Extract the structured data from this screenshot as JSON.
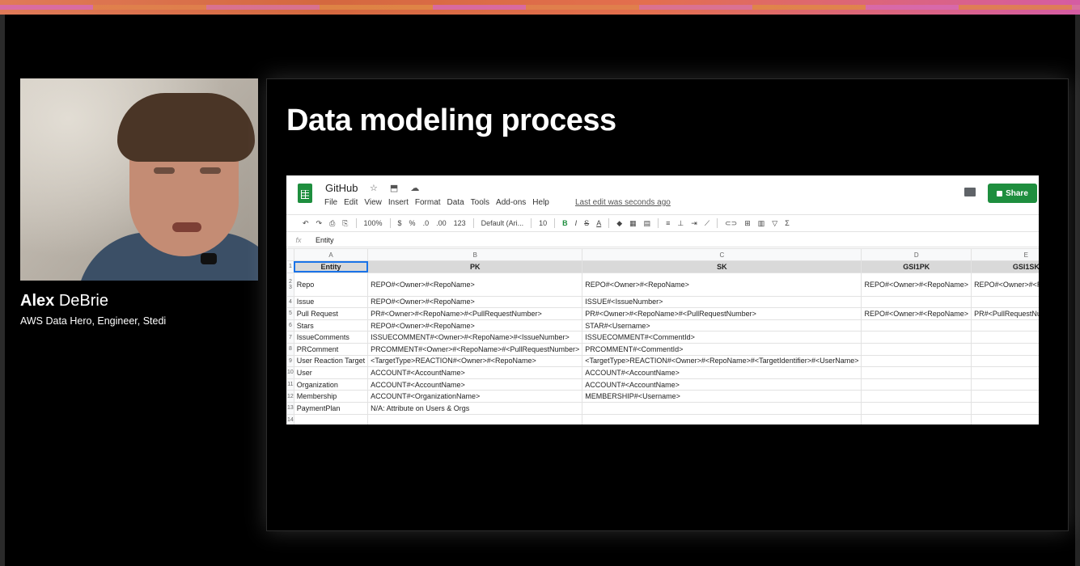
{
  "speaker": {
    "first_name": "Alex",
    "last_name": "DeBrie",
    "role": "AWS Data Hero, Engineer, Stedi"
  },
  "slide": {
    "title": "Data modeling process"
  },
  "sheets": {
    "doc_title": "GitHub",
    "title_icons": "☆ ⬒ ☁",
    "menu": [
      "File",
      "Edit",
      "View",
      "Insert",
      "Format",
      "Data",
      "Tools",
      "Add-ons",
      "Help"
    ],
    "last_edit": "Last edit was seconds ago",
    "share_label": "Share",
    "toolbar": {
      "undo": "↶",
      "redo": "↷",
      "print": "⎙",
      "paint": "⎘",
      "zoom": "100%",
      "currency": "$",
      "percent": "%",
      "dec_less": ".0",
      "dec_more": ".00",
      "more_formats": "123",
      "font": "Default (Ari...",
      "font_size": "10",
      "bold": "B",
      "italic": "I",
      "strike": "S",
      "text_color": "A",
      "sum": "Σ"
    },
    "formula_bar": {
      "fx": "fx",
      "value": "Entity"
    },
    "columns": [
      "A",
      "B",
      "C",
      "D",
      "E"
    ],
    "header_row": [
      "Entity",
      "PK",
      "SK",
      "GSI1PK",
      "GSI1SK"
    ],
    "rows": [
      {
        "num": "2",
        "cells": [
          "Repo",
          "REPO#<Owner>#<RepoName>",
          "REPO#<Owner>#<RepoName>",
          "REPO#<Owner>#<RepoName>",
          "REPO#<Owner>#<RepoName>"
        ],
        "num2": "3"
      },
      {
        "num": "4",
        "cells": [
          "Issue",
          "REPO#<Owner>#<RepoName>",
          "ISSUE#<IssueNumber>",
          "",
          ""
        ]
      },
      {
        "num": "5",
        "cells": [
          "Pull Request",
          "PR#<Owner>#<RepoName>#<PullRequestNumber>",
          "PR#<Owner>#<RepoName>#<PullRequestNumber>",
          "REPO#<Owner>#<RepoName>",
          "PR#<PullRequestNumber>"
        ]
      },
      {
        "num": "6",
        "cells": [
          "Stars",
          "REPO#<Owner>#<RepoName>",
          "STAR#<Username>",
          "",
          ""
        ]
      },
      {
        "num": "7",
        "cells": [
          "IssueComments",
          "ISSUECOMMENT#<Owner>#<RepoName>#<IssueNumber>",
          "ISSUECOMMENT#<CommentId>",
          "",
          ""
        ]
      },
      {
        "num": "8",
        "cells": [
          "PRComment",
          "PRCOMMENT#<Owner>#<RepoName>#<PullRequestNumber>",
          "PRCOMMENT#<CommentId>",
          "",
          ""
        ]
      },
      {
        "num": "9",
        "cells": [
          "User Reaction Target",
          "<TargetType>REACTION#<Owner>#<RepoName>",
          "<TargetType>REACTION#<Owner>#<RepoName>#<TargetIdentifier>#<UserName>",
          "",
          ""
        ]
      },
      {
        "num": "10",
        "cells": [
          "User",
          "ACCOUNT#<AccountName>",
          "ACCOUNT#<AccountName>",
          "",
          ""
        ]
      },
      {
        "num": "11",
        "cells": [
          "Organization",
          "ACCOUNT#<AccountName>",
          "ACCOUNT#<AccountName>",
          "",
          ""
        ]
      },
      {
        "num": "12",
        "cells": [
          "Membership",
          "ACCOUNT#<OrganizationName>",
          "MEMBERSHIP#<Username>",
          "",
          ""
        ]
      },
      {
        "num": "13",
        "cells": [
          "PaymentPlan",
          "N/A: Attribute on Users & Orgs",
          "",
          "",
          ""
        ]
      },
      {
        "num": "14",
        "cells": [
          "",
          "",
          "",
          "",
          ""
        ]
      }
    ],
    "colors": {
      "brand_green": "#1e8e3e",
      "selection_blue": "#1a73e8",
      "header_gray": "#d9d9d9"
    }
  }
}
